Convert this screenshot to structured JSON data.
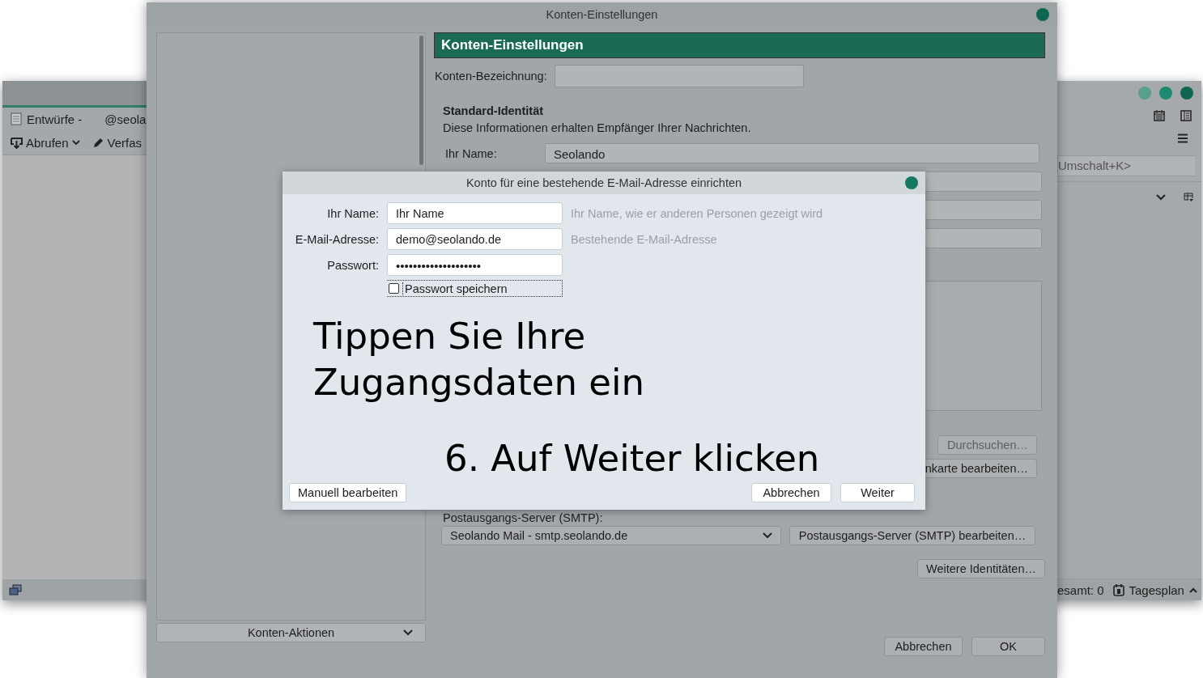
{
  "mail_window": {
    "folder_tab": "Entwürfe -",
    "account_fragment": "@seola",
    "toolbar": [
      {
        "kind": "get",
        "label": "Abrufen"
      },
      {
        "kind": "write",
        "label": "Verfas"
      }
    ],
    "search": {
      "placeholder": "Umschalt+K>"
    },
    "status": {
      "count": "esamt: 0",
      "today_pane": "Tagesplan"
    }
  },
  "settings_window": {
    "title": "Konten-Einstellungen",
    "header": "Konten-Einstellungen",
    "account_name_label": "Konten-Bezeichnung:",
    "section_title": "Standard-Identität",
    "section_description": "Diese Informationen erhalten Empfänger Ihrer Nachrichten.",
    "name_field": {
      "label": "Ihr Name:",
      "value": "Seolando"
    },
    "side_buttons": [
      {
        "label": "Durchsuchen…",
        "disabled": true
      },
      {
        "label": "nkarte bearbeiten…",
        "disabled": false
      }
    ],
    "smtp_label": "Postausgangs-Server (SMTP):",
    "smtp_select": "Seolando Mail - smtp.seolando.de",
    "smtp_edit": "Postausgangs-Server (SMTP) bearbeiten…",
    "more_identities": "Weitere Identitäten…",
    "account_actions": "Konten-Aktionen",
    "footer_buttons": [
      "Abbrechen",
      "OK"
    ]
  },
  "dialog": {
    "title": "Konto für eine bestehende E-Mail-Adresse einrichten",
    "fields": [
      {
        "kind": "text",
        "label": "Ihr Name:",
        "value": "Ihr Name",
        "hint": "Ihr Name, wie er anderen Personen gezeigt wird"
      },
      {
        "kind": "text",
        "label": "E-Mail-Adresse:",
        "value": "demo@seolando.de",
        "hint": "Bestehende E-Mail-Adresse"
      },
      {
        "kind": "password",
        "label": "Passwort:",
        "value": "••••••••••••••••••••"
      }
    ],
    "remember_password": {
      "label": "Passwort speichern",
      "checked": false
    },
    "annotations": [
      "Tippen Sie Ihre Zugangsdaten ein",
      "6. Auf Weiter klicken"
    ],
    "manual_button": "Manuell bearbeiten",
    "buttons": [
      "Abbrechen",
      "Weiter"
    ]
  }
}
